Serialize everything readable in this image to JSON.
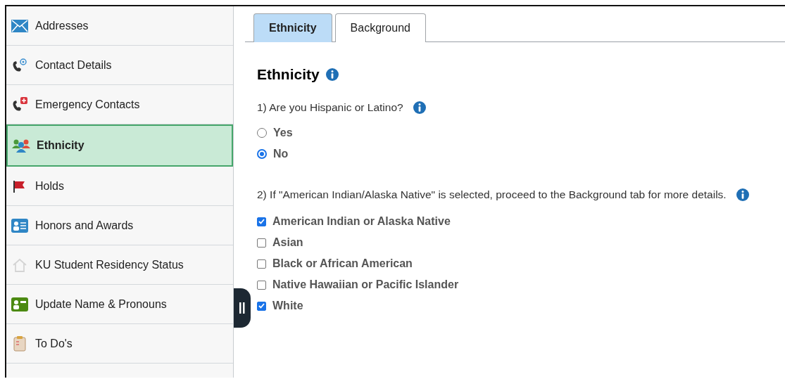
{
  "sidebar": {
    "items": [
      {
        "label": "Addresses",
        "selected": false
      },
      {
        "label": "Contact Details",
        "selected": false
      },
      {
        "label": "Emergency Contacts",
        "selected": false
      },
      {
        "label": "Ethnicity",
        "selected": true
      },
      {
        "label": "Holds",
        "selected": false
      },
      {
        "label": "Honors and Awards",
        "selected": false
      },
      {
        "label": "KU Student Residency Status",
        "selected": false
      },
      {
        "label": "Update Name & Pronouns",
        "selected": false
      },
      {
        "label": "To Do's",
        "selected": false
      }
    ]
  },
  "tabs": [
    {
      "label": "Ethnicity",
      "selected": true
    },
    {
      "label": "Background",
      "selected": false
    }
  ],
  "heading": "Ethnicity",
  "question_1": {
    "text": "1) Are you Hispanic or Latino?",
    "options": [
      {
        "label": "Yes",
        "selected": false
      },
      {
        "label": "No",
        "selected": true
      }
    ]
  },
  "question_2": {
    "text": "2) If \"American Indian/Alaska Native\" is selected, proceed to the Background tab for more details.",
    "options": [
      {
        "label": "American Indian or Alaska Native",
        "checked": true
      },
      {
        "label": "Asian",
        "checked": false
      },
      {
        "label": "Black or African American",
        "checked": false
      },
      {
        "label": "Native Hawaiian or Pacific Islander",
        "checked": false
      },
      {
        "label": "White",
        "checked": true
      }
    ]
  }
}
